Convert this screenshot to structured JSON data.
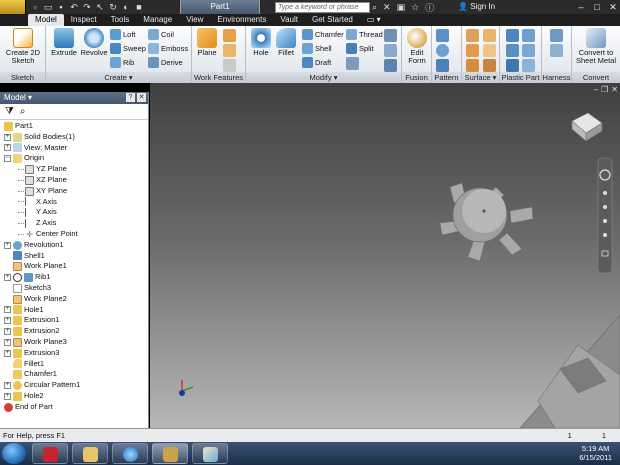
{
  "window": {
    "title": "Part1",
    "search_placeholder": "Type a keyword or phrase",
    "signin": "Sign In",
    "minimize": "–",
    "maximize": "□",
    "close": "✕"
  },
  "tabs": [
    "Model",
    "Inspect",
    "Tools",
    "Manage",
    "View",
    "Environments",
    "Vault",
    "Get Started"
  ],
  "ribbon": {
    "sketch": {
      "title": "Sketch",
      "create_label": "Create 2D Sketch"
    },
    "create": {
      "title": "Create ▾",
      "extrude": "Extrude",
      "revolve": "Revolve",
      "loft": "Loft",
      "sweep": "Sweep",
      "rib": "Rib",
      "coil": "Coil",
      "emboss": "Emboss",
      "derive": "Derive"
    },
    "work_features": {
      "title": "Work Features",
      "plane": "Plane"
    },
    "modify": {
      "title": "Modify ▾",
      "hole": "Hole",
      "fillet": "Fillet",
      "chamfer": "Chamfer",
      "shell": "Shell",
      "draft": "Draft",
      "thread": "Thread",
      "split": "Split"
    },
    "fusion": {
      "title": "Fusion",
      "edit_form": "Edit Form"
    },
    "pattern": {
      "title": "Pattern"
    },
    "surface": {
      "title": "Surface ▾"
    },
    "plastic_part": {
      "title": "Plastic Part"
    },
    "harness": {
      "title": "Harness"
    },
    "convert": {
      "title": "Convert",
      "label": "Convert to Sheet Metal"
    }
  },
  "browser": {
    "title": "Model ▾",
    "items": [
      {
        "label": "Part1"
      },
      {
        "label": "Solid Bodies(1)"
      },
      {
        "label": "View: Master"
      },
      {
        "label": "Origin"
      },
      {
        "label": "YZ Plane"
      },
      {
        "label": "XZ Plane"
      },
      {
        "label": "XY Plane"
      },
      {
        "label": "X Axis"
      },
      {
        "label": "Y Axis"
      },
      {
        "label": "Z Axis"
      },
      {
        "label": "Center Point"
      },
      {
        "label": "Revolution1"
      },
      {
        "label": "Shell1"
      },
      {
        "label": "Work Plane1"
      },
      {
        "label": "Rib1"
      },
      {
        "label": "Sketch3"
      },
      {
        "label": "Work Plane2"
      },
      {
        "label": "Hole1"
      },
      {
        "label": "Extrusion1"
      },
      {
        "label": "Extrusion2"
      },
      {
        "label": "Work Plane3"
      },
      {
        "label": "Extrusion3"
      },
      {
        "label": "Fillet1"
      },
      {
        "label": "Chamfer1"
      },
      {
        "label": "Circular Pattern1"
      },
      {
        "label": "Hole2"
      },
      {
        "label": "End of Part"
      }
    ]
  },
  "status": {
    "help": "For Help, press F1",
    "count1": "1",
    "count2": "1"
  },
  "clock": {
    "time": "5:19 AM",
    "date": "6/15/2011"
  }
}
